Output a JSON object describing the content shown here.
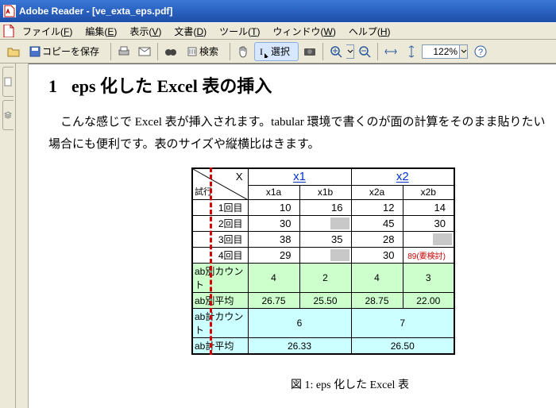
{
  "titlebar": {
    "title": "Adobe Reader - [ve_exta_eps.pdf]"
  },
  "menubar": {
    "items": [
      {
        "label": "ファイル",
        "acc": "F"
      },
      {
        "label": "編集",
        "acc": "E"
      },
      {
        "label": "表示",
        "acc": "V"
      },
      {
        "label": "文書",
        "acc": "D"
      },
      {
        "label": "ツール",
        "acc": "T"
      },
      {
        "label": "ウィンドウ",
        "acc": "W"
      },
      {
        "label": "ヘルプ",
        "acc": "H"
      }
    ]
  },
  "toolbar": {
    "save_label": "コピーを保存",
    "search_label": "検索",
    "select_label": "選択",
    "zoom_value": "122%"
  },
  "doc": {
    "heading_num": "1",
    "heading_text": "eps 化した Excel 表の挿入",
    "para": "こんな感じで Excel 表が挿入されます。tabular 環境で書くのが面の計算をそのまま貼りたい場合にも便利です。表のサイズや縦横比はきます。",
    "caption": "図 1: eps 化した Excel 表",
    "table": {
      "diag_x": "X",
      "diag_y": "試行",
      "x1": "x1",
      "x2": "x2",
      "x1a": "x1a",
      "x1b": "x1b",
      "x2a": "x2a",
      "x2b": "x2b",
      "rows": [
        {
          "l": "1回目",
          "a": "10",
          "b": "16",
          "c": "12",
          "d": "14"
        },
        {
          "l": "2回目",
          "a": "30",
          "b": "",
          "c": "45",
          "d": "30"
        },
        {
          "l": "3回目",
          "a": "38",
          "b": "35",
          "c": "28",
          "d": ""
        },
        {
          "l": "4回目",
          "a": "29",
          "b": "",
          "c": "30",
          "d": "89(要検討)"
        }
      ],
      "g1": {
        "l": "ab別カウント",
        "a": "4",
        "b": "2",
        "c": "4",
        "d": "3"
      },
      "g2": {
        "l": "ab別平均",
        "a": "26.75",
        "b": "25.50",
        "c": "28.75",
        "d": "22.00"
      },
      "c1": {
        "l": "ab計カウント",
        "ab": "6",
        "cd": "7"
      },
      "c2": {
        "l": "ab計平均",
        "ab": "26.33",
        "cd": "26.50"
      }
    }
  }
}
